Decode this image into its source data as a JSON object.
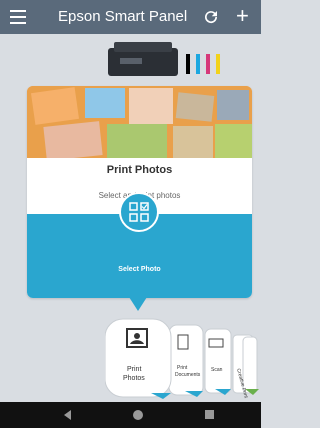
{
  "app": {
    "title": "Epson Smart Panel"
  },
  "card": {
    "title": "Print Photos",
    "subtitle": "Select and print photos",
    "action_label": "Select Photo"
  },
  "carousel": {
    "items": [
      {
        "label_line1": "Print",
        "label_line2": "Photos",
        "icon": "photo-icon"
      },
      {
        "label_line1": "Print",
        "label_line2": "Documents",
        "icon": "document-icon"
      },
      {
        "label": "Scan",
        "icon": "scanner-icon"
      },
      {
        "label": "Creative Print",
        "icon": "creative-icon"
      }
    ]
  },
  "colors": {
    "accent": "#2aa6cf",
    "appbar": "#5a6a7b",
    "background": "#d9dde2",
    "nav": "#111111"
  }
}
